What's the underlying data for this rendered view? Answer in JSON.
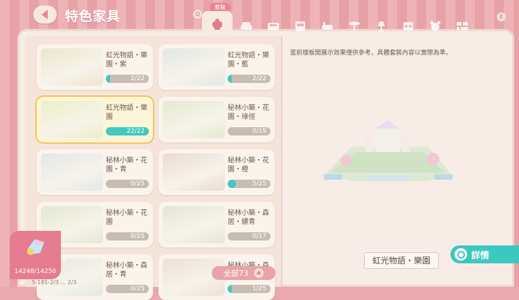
{
  "header": {
    "title": "特色家具",
    "back_icon": "back-arrow-icon",
    "key_q": "Q",
    "key_e": "E"
  },
  "tabs": {
    "active_label": "套裝",
    "items": [
      {
        "icon": "outfit-set-icon"
      },
      {
        "icon": "sofa-icon"
      },
      {
        "icon": "bed-icon"
      },
      {
        "icon": "cabinet-icon"
      },
      {
        "icon": "bathtub-icon"
      },
      {
        "icon": "table-icon"
      },
      {
        "icon": "lamp-icon"
      },
      {
        "icon": "appliance-icon"
      },
      {
        "icon": "bear-plush-icon"
      },
      {
        "icon": "wall-icon"
      }
    ]
  },
  "furniture_sets": [
    {
      "name": "虹光物語・樂園・紫",
      "progress": "2/22",
      "fraction": 0.09,
      "tint": "#ece3c9"
    },
    {
      "name": "虹光物語・樂園・藍",
      "progress": "2/22",
      "fraction": 0.09,
      "tint": "#dfe5e4"
    },
    {
      "name": "虹光物語・樂園",
      "progress": "22/22",
      "fraction": 1.0,
      "tint": "#e8eec6",
      "selected": true
    },
    {
      "name": "秘林小築・花園・綠徑",
      "progress": "0/19",
      "fraction": 0,
      "tint": "#e3e8cc"
    },
    {
      "name": "秘林小築・花園・青",
      "progress": "0/25",
      "fraction": 0,
      "tint": "#dfe6e6"
    },
    {
      "name": "秘林小築・花園・橙",
      "progress": "5/25",
      "fraction": 0.2,
      "tint": "#ead7d2"
    },
    {
      "name": "秘林小築・花園",
      "progress": "0/25",
      "fraction": 0,
      "tint": "#e0e6cf"
    },
    {
      "name": "秘林小築・森居・縹青",
      "progress": "0/17",
      "fraction": 0,
      "tint": "#e5e3d3"
    },
    {
      "name": "秘林小築・森居・青",
      "progress": "0/25",
      "fraction": 0,
      "tint": "#e3e7df"
    },
    {
      "name": "秘林小築・森",
      "progress": "1/25",
      "fraction": 0.04,
      "tint": "#ecdcd4"
    }
  ],
  "preview": {
    "notice": "當前樣板間展示效果僅供參考，具體套裝內容以實際為準。",
    "name": "虹光物語・樂園",
    "details_label": "詳情"
  },
  "filter": {
    "label": "全部73"
  },
  "resource": {
    "value": "14248/14250",
    "icon": "crystal-gem-icon"
  },
  "footer": {
    "text": "5-181-2/3 ... 2/3"
  }
}
